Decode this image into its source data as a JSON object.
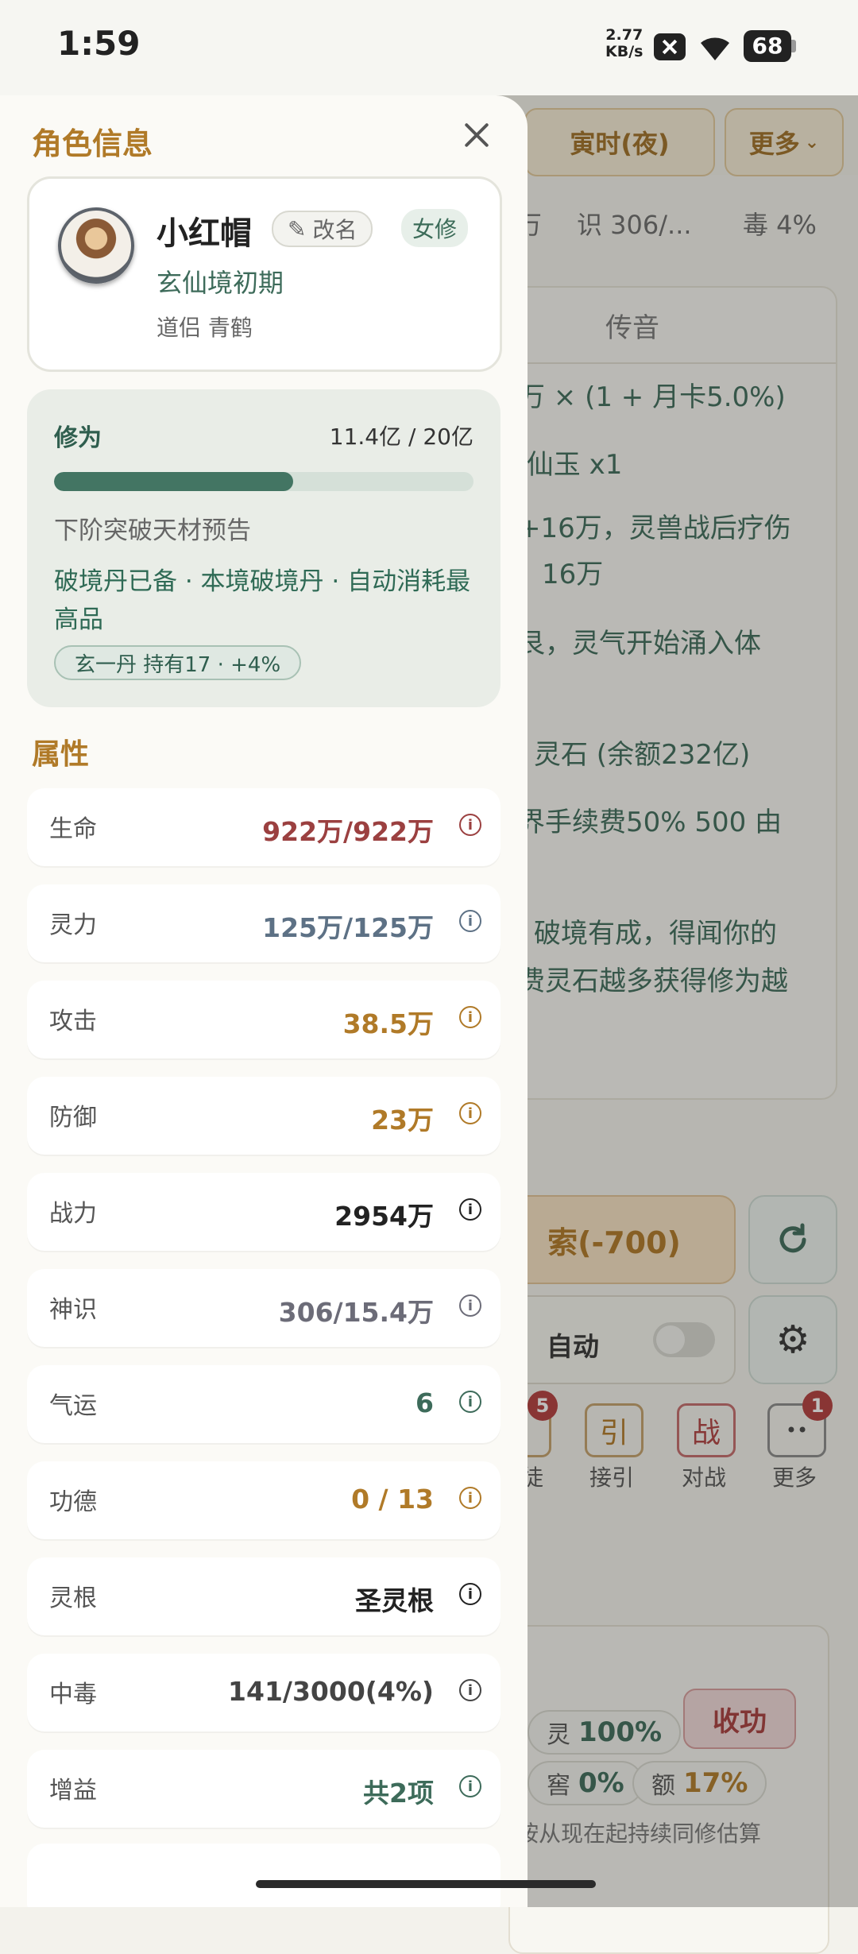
{
  "status_bar": {
    "time": "1:59",
    "net_speed_value": "2.77",
    "net_speed_unit": "KB/s",
    "battery": "68"
  },
  "background": {
    "time_chip": "寅时(夜)",
    "more_chip": "更多",
    "stats": {
      "shi_left": "万",
      "shishi": "识 306/...",
      "du": "毒 4%"
    },
    "tab": "传音",
    "lines": [
      "万 × (1 + 月卡5.0%)",
      "·仙玉 x1",
      "+16万，灵兽战后疗伤",
      "16万",
      "艮，灵气开始涌入体",
      "灵石 (余额232亿)",
      "界手续费50% 500 由",
      "破境有成，得闻你的",
      "费灵石越多获得修为越"
    ],
    "explore_btn": "索(-700)",
    "auto_label": "自动",
    "icons": [
      {
        "char": "引",
        "label": "接引"
      },
      {
        "char": "战",
        "label": "对战"
      },
      {
        "char": "••",
        "label": "更多"
      }
    ],
    "icon_partial_label": "徒",
    "badge_left": "5",
    "badge_right": "1",
    "shougong_btn": "收功",
    "pill_ling": "灵",
    "pill_ling_val": "100%",
    "pill_jiao": "窖",
    "pill_jiao_val": "0%",
    "pill_e": "额",
    "pill_e_val": "17%",
    "footer_note": "按从现在起持续同修估算"
  },
  "drawer": {
    "title": "角色信息",
    "profile": {
      "name": "小红帽",
      "rename_label": "改名",
      "gender": "女修",
      "realm": "玄仙境初期",
      "companion": "道侣 青鹤"
    },
    "cultivation": {
      "label": "修为",
      "value": "11.4亿 / 20亿",
      "progress": 0.57,
      "preview": "下阶突破天材预告",
      "note": "破境丹已备 · 本境破境丹 · 自动消耗最高品",
      "pill": "玄一丹 持有17 · +4%"
    },
    "attributes_title": "属性",
    "attributes": [
      {
        "label": "生命",
        "value": "922万/922万",
        "color": "#9b4040"
      },
      {
        "label": "灵力",
        "value": "125万/125万",
        "color": "#5d7185"
      },
      {
        "label": "攻击",
        "value": "38.5万",
        "color": "#b07a28"
      },
      {
        "label": "防御",
        "value": "23万",
        "color": "#b07a28"
      },
      {
        "label": "战力",
        "value": "2954万",
        "color": "#222222"
      },
      {
        "label": "神识",
        "value": "306/15.4万",
        "color": "#6c6c78"
      },
      {
        "label": "气运",
        "value": "6",
        "color": "#3d6b5a"
      },
      {
        "label": "功德",
        "value": "0 / 13",
        "color": "#b07a28"
      },
      {
        "label": "灵根",
        "value": "圣灵根",
        "color": "#222222"
      },
      {
        "label": "中毒",
        "value": "141/3000(4%)",
        "color": "#444444"
      },
      {
        "label": "增益",
        "value": "共2项",
        "color": "#3d6b5a"
      }
    ]
  }
}
